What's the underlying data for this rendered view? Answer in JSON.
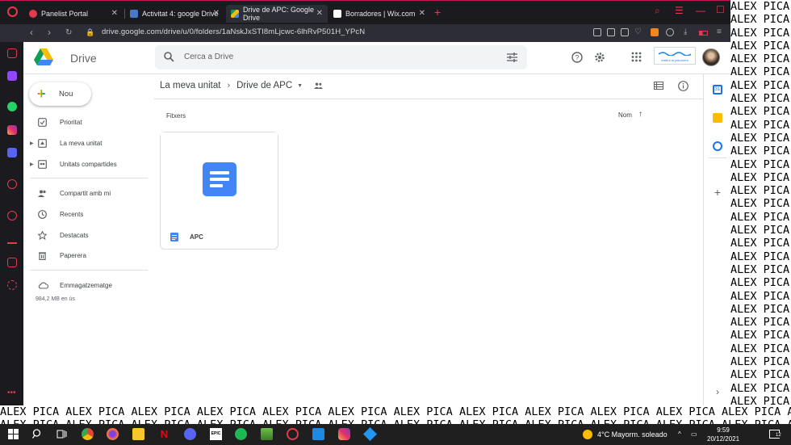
{
  "browser": {
    "tabs": [
      {
        "label": "Panelist Portal",
        "favicon_color": "#e53950"
      },
      {
        "label": "Activitat 4: google Drive",
        "favicon_color": "#4a78c8"
      },
      {
        "label": "Drive de APC: Google Drive",
        "favicon_color": "#fbbc04"
      },
      {
        "label": "Borradores | Wix.com",
        "favicon_color": "#ffffff"
      }
    ],
    "new_tab_symbol": "+",
    "url": "drive.google.com/drive/u/0/folders/1aNskJxSTI8mLjcwc-6lhRvP501H_YPcN",
    "accent_color": "#e53950"
  },
  "drive": {
    "app_name": "Drive",
    "search_placeholder": "Cerca a Drive",
    "new_button_label": "Nou",
    "nav_items": [
      {
        "label": "Prioritat",
        "icon": "check-box-icon"
      },
      {
        "label": "La meva unitat",
        "icon": "my-drive-icon"
      },
      {
        "label": "Unitats compartides",
        "icon": "shared-drives-icon"
      },
      {
        "label": "Compartit amb mi",
        "icon": "people-icon"
      },
      {
        "label": "Recents",
        "icon": "clock-icon"
      },
      {
        "label": "Destacats",
        "icon": "star-icon"
      },
      {
        "label": "Paperera",
        "icon": "trash-icon"
      },
      {
        "label": "Emmagatzematge",
        "icon": "cloud-icon"
      }
    ],
    "storage_used": "984,2 MB en ús",
    "breadcrumb": {
      "root": "La meva unitat",
      "current": "Drive de APC"
    },
    "section_title": "Fitxers",
    "sort_label": "Nom",
    "files": [
      {
        "name": "APC",
        "type": "google-doc"
      }
    ],
    "school_logo_text": "institut la palomera"
  },
  "wallpaper_text": "ALEX PICA",
  "taskbar": {
    "weather": "4°C  Mayorm. soleado",
    "time": "9:59",
    "date": "20/12/2021",
    "notifications": "12"
  }
}
